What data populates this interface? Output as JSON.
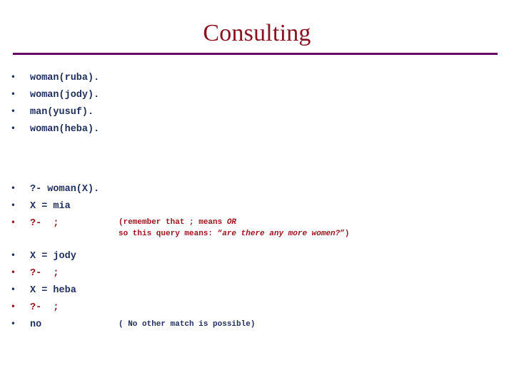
{
  "slide": {
    "title": "Consulting",
    "colors": {
      "title": "#8C1020",
      "rule": "#660066",
      "code_navy": "#1F2D5C",
      "code_red": "#99121C",
      "background": "#FFFFFF"
    }
  },
  "facts": {
    "items": [
      {
        "text": "woman(ruba).",
        "color": "navy"
      },
      {
        "text": "woman(jody).",
        "color": "navy"
      },
      {
        "text": "man(yusuf).",
        "color": "navy"
      },
      {
        "text": "woman(heba).",
        "color": "navy"
      }
    ]
  },
  "query": {
    "items": [
      {
        "text": "?- woman(X).",
        "color": "navy"
      },
      {
        "text": "X = mia",
        "color": "navy"
      },
      {
        "text": "?-  ;",
        "color": "red"
      }
    ],
    "annotation": {
      "line1_pre": "(remember that ; means ",
      "line1_em": "OR",
      "line2_pre": "so this query means: “",
      "line2_em": "are there any more women?",
      "line2_post": "”)"
    }
  },
  "results": {
    "items": [
      {
        "text": "X = jody",
        "color": "navy"
      },
      {
        "text": "?-  ;",
        "color": "red"
      },
      {
        "text": "X = heba",
        "color": "navy"
      },
      {
        "text": "?-  ;",
        "color": "red"
      },
      {
        "text": "no",
        "color": "navy"
      }
    ],
    "annotation": "( No other match is possible)"
  }
}
